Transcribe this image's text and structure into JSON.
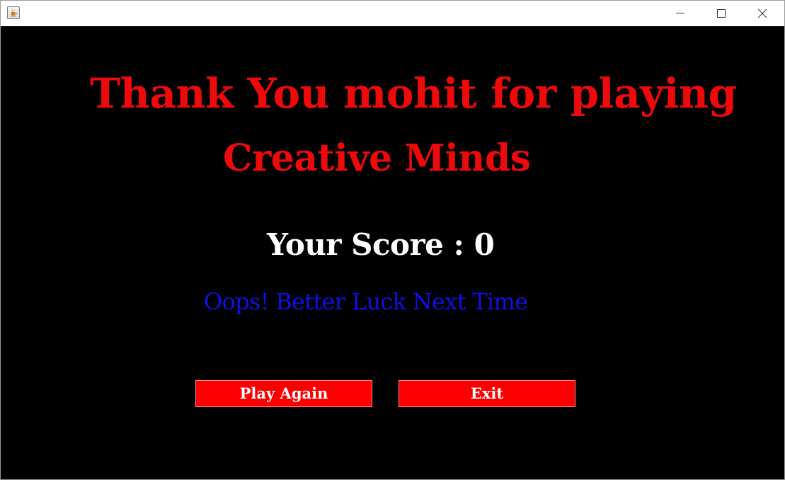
{
  "window": {
    "app_icon": "java-cup-icon",
    "controls": {
      "minimize_icon": "minimize-icon",
      "maximize_icon": "maximize-icon",
      "close_icon": "close-icon"
    }
  },
  "main": {
    "thank_you": "Thank You mohit for playing",
    "game_name": "Creative Minds",
    "score_text": "Your Score : 0",
    "message": "Oops! Better Luck Next Time",
    "buttons": {
      "play_again": "Play Again",
      "exit": "Exit"
    }
  },
  "colors": {
    "background": "#000000",
    "title": "#ee0a0a",
    "score": "#ffffff",
    "message": "#1010e6",
    "button_bg": "#fb0000",
    "button_text": "#ffffff"
  }
}
